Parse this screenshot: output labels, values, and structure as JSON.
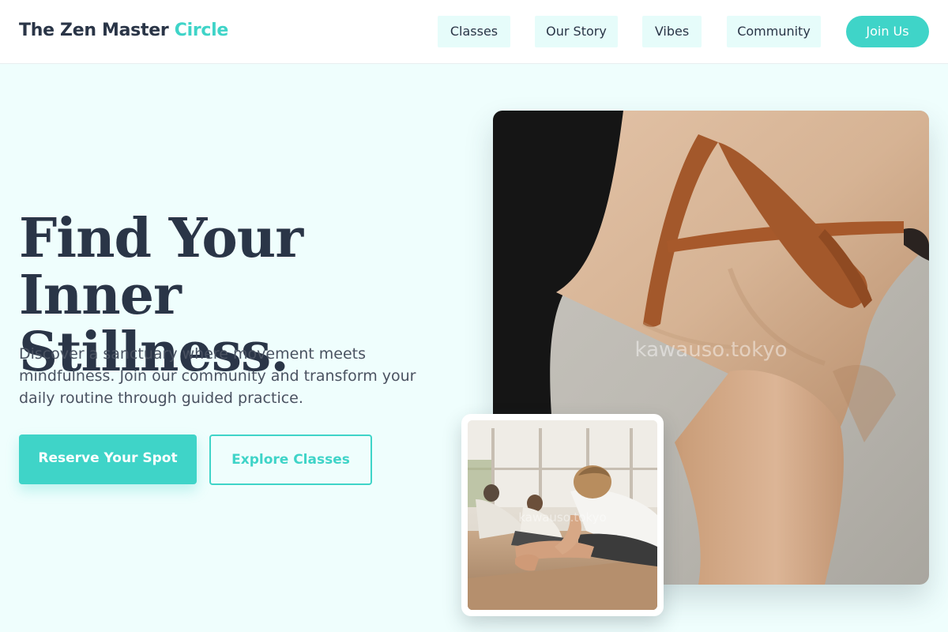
{
  "brand": {
    "name_main": "The Zen Master",
    "name_accent": "Circle"
  },
  "nav": {
    "items": [
      {
        "label": "Classes"
      },
      {
        "label": "Our Story"
      },
      {
        "label": "Vibes"
      },
      {
        "label": "Community"
      }
    ],
    "cta_label": "Join Us"
  },
  "hero": {
    "title_line1": "Find Your Inner",
    "title_line2": "Stillness.",
    "subtitle": "Discover a sanctuary where movement meets mindfulness. Join our community and transform your daily routine through guided practice.",
    "primary_label": "Reserve Your Spot",
    "secondary_label": "Explore Classes"
  },
  "images": {
    "main_watermark": "kawauso.tokyo",
    "inset_watermark": "kawauso.tokyo"
  },
  "colors": {
    "accent": "#3fd4c8",
    "page_background": "#effefd",
    "nav_pill": "#e6fcfa",
    "text_dark": "#2a3547"
  }
}
